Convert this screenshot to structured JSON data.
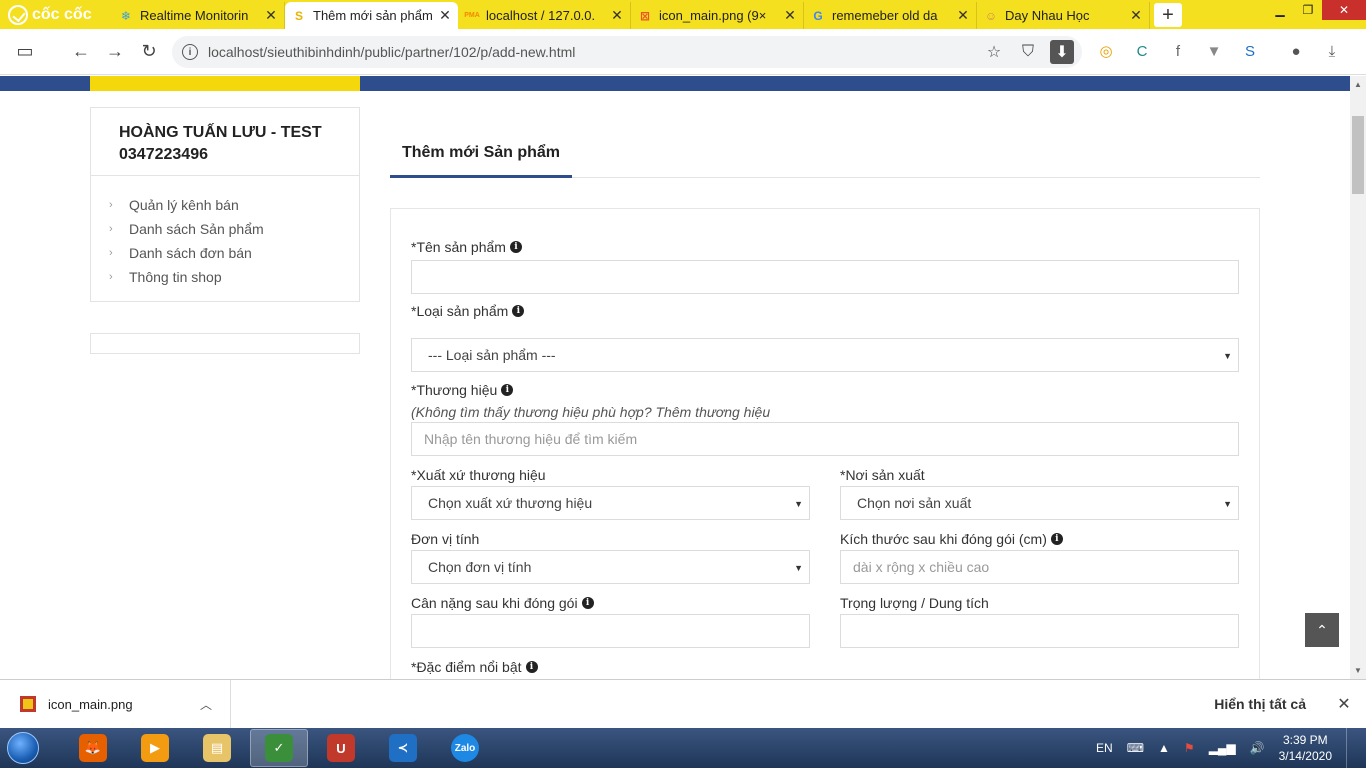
{
  "browser": {
    "brand": "cốc cốc",
    "tabs": [
      {
        "label": "Realtime Monitorin",
        "icon": "snowflake-icon",
        "icon_char": "❄",
        "icon_color": "#3aa0d8",
        "active": false
      },
      {
        "label": "Thêm mới sản phẩm",
        "icon": "s-logo-icon",
        "icon_char": "S",
        "icon_color": "#e8b400",
        "active": true
      },
      {
        "label": "localhost / 127.0.0.",
        "icon": "phpmyadmin-icon",
        "icon_char": "PMA",
        "icon_color": "#f08a00",
        "active": false
      },
      {
        "label": "icon_main.png (9×",
        "icon": "xampp-icon",
        "icon_char": "⊠",
        "icon_color": "#e8572c",
        "active": false
      },
      {
        "label": "rememeber old da",
        "icon": "google-icon",
        "icon_char": "G",
        "icon_color": "#4285f4",
        "active": false
      },
      {
        "label": "Day Nhau Học",
        "icon": "avatar-icon",
        "icon_char": "☺",
        "icon_color": "#d08a4b",
        "active": false
      }
    ],
    "url": "localhost/sieuthibinhdinh/public/partner/102/p/add-new.html"
  },
  "sidebar": {
    "shop_name": "HOÀNG TUẤN LƯU - TEST",
    "shop_phone": "0347223496",
    "items": [
      {
        "label": "Quản lý kênh bán"
      },
      {
        "label": "Danh sách Sản phẩm"
      },
      {
        "label": "Danh sách đơn bán"
      },
      {
        "label": "Thông tin shop"
      }
    ]
  },
  "main": {
    "tab_label": "Thêm mới Sản phẩm",
    "form": {
      "product_name_label": "*Tên sản phẩm",
      "product_name_value": "",
      "product_type_label": "*Loại sản phẩm",
      "product_type_selected": "--- Loại sản phẩm ---",
      "brand_label": "*Thương hiệu",
      "brand_hint": "(Không tìm thấy thương hiệu phù hợp? Thêm thương hiệu",
      "brand_placeholder": "Nhập tên thương hiệu để tìm kiếm",
      "origin_label": "*Xuất xứ thương hiệu",
      "origin_selected": "Chọn xuất xứ thương hiệu",
      "made_in_label": "*Nơi sản xuất",
      "made_in_selected": "Chọn nơi sản xuất",
      "unit_label": "Đơn vị tính",
      "unit_selected": "Chọn đơn vị tính",
      "size_label": "Kích thước sau khi đóng gói (cm)",
      "size_placeholder": "dài x rộng x chiều cao",
      "weight_label": "Cân nặng sau khi đóng gói",
      "weight_value": "",
      "volume_label": "Trọng lượng / Dung tích",
      "volume_value": "",
      "highlight_label": "*Đặc điểm nổi bật"
    }
  },
  "download_bar": {
    "file_name": "icon_main.png",
    "show_all": "Hiển thị tất cả"
  },
  "taskbar": {
    "apps": [
      {
        "name": "firefox",
        "glyph": "🦊",
        "color": "#e66000"
      },
      {
        "name": "media-player",
        "glyph": "▶",
        "color": "#f39c12"
      },
      {
        "name": "file-explorer",
        "glyph": "▤",
        "color": "#e8c468"
      },
      {
        "name": "coccoc",
        "glyph": "✓",
        "color": "#3b8f3b",
        "active": true
      },
      {
        "name": "unikey",
        "glyph": "U",
        "color": "#c0392b"
      },
      {
        "name": "vscode",
        "glyph": "≺",
        "color": "#1f6fc5"
      },
      {
        "name": "zalo",
        "glyph": "Zalo",
        "color": "#1e88e5"
      }
    ],
    "language": "EN",
    "time": "3:39 PM",
    "date": "3/14/2020"
  },
  "colors": {
    "accent": "#2e4d8c",
    "brand_yellow": "#f5d80b"
  }
}
